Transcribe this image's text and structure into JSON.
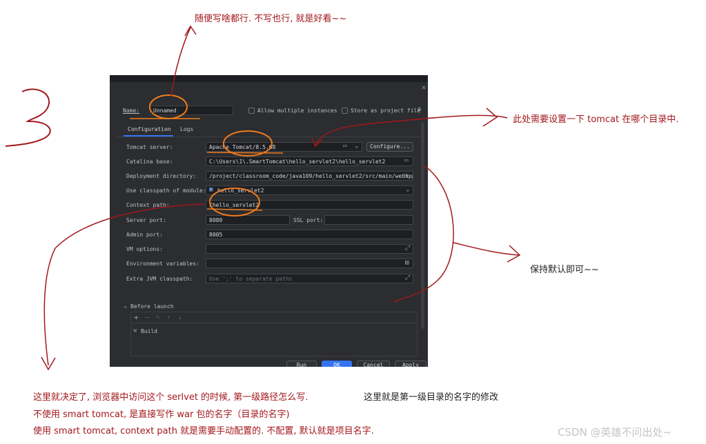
{
  "dialog": {
    "name_label": "Name:",
    "name_value": "Unnamed",
    "allow_multiple": "Allow multiple instances",
    "store_project": "Store as project file",
    "tabs": [
      {
        "label": "Configuration",
        "active": true
      },
      {
        "label": "Logs",
        "active": false
      }
    ],
    "fields": {
      "tomcat_server_label": "Tomcat server:",
      "tomcat_server_value": "Apache Tomcat/8.5.68",
      "configure_button": "Configure...",
      "catalina_label": "Catalina base:",
      "catalina_value": "C:\\Users\\1\\.SmartTomcat\\hello_servlet2\\hello_servlet2",
      "deploy_label": "Deployment directory:",
      "deploy_value": "/project/classroom_code/java109/hello_servlet2/src/main/webapp",
      "classpath_label": "Use classpath of module:",
      "classpath_value": "hello_servlet2",
      "context_label": "Context path:",
      "context_value": "/hello_servlet2",
      "server_port_label": "Server port:",
      "server_port_value": "8080",
      "ssl_port_label": "SSL port:",
      "admin_port_label": "Admin port:",
      "admin_port_value": "8005",
      "vm_label": "VM options:",
      "env_label": "Environment variables:",
      "extra_label": "Extra JVM classpath:",
      "extra_placeholder": "Use ';' to separate paths"
    },
    "before_launch": "Before launch",
    "build_item": "Build",
    "footer": {
      "run": "Run",
      "ok": "OK",
      "cancel": "Cancel",
      "apply": "Apply"
    }
  },
  "annotations": {
    "big_number": "3",
    "top_note": "随便写啥都行. 不写也行, 就是好看~~",
    "right_note_1": "此处需要设置一下 tomcat 在哪个目录中.",
    "right_note_2": "保持默认即可~~",
    "bottom_line_1a": "这里就决定了, 浏览器中访问这个 serlvet 的时候, 第一级路径怎么写.",
    "bottom_line_1b": "这里就是第一级目录的名字的修改",
    "bottom_line_2": "不使用 smart tomcat, 是直接写作 war 包的名字（目录的名字)",
    "bottom_line_3": "使用 smart tomcat, context path 就是需要手动配置的. 不配置, 默认就是项目名字."
  },
  "watermark": "CSDN @英雄不问出处~",
  "colors": {
    "dialog_bg": "#2b2d30",
    "field_bg": "#1e1f22",
    "accent_blue": "#3574f0",
    "annotation_red": "#a3171c",
    "highlight_orange": "#f07c1c"
  }
}
